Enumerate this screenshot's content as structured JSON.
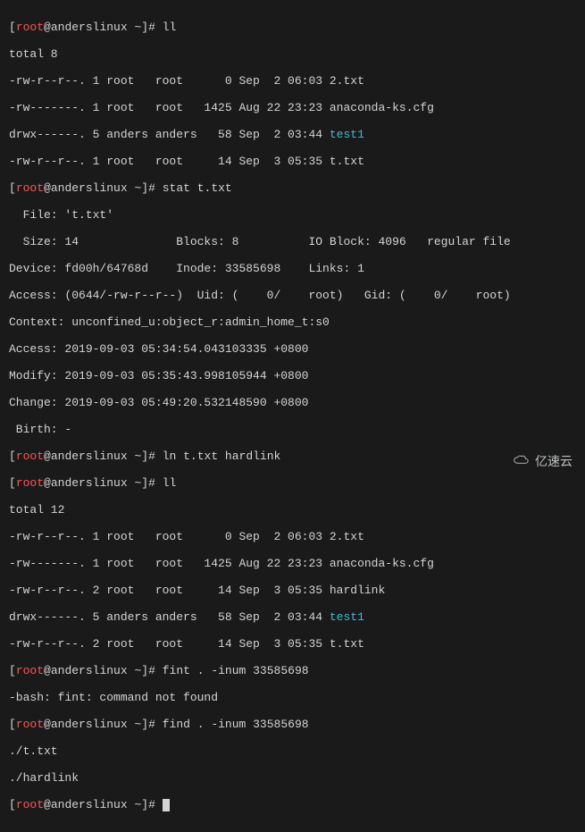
{
  "prompt": {
    "user": "root",
    "at": "@",
    "host": "anderslinux",
    "path": "~",
    "open": "[",
    "close": "]#"
  },
  "cmds": {
    "c0": "ll",
    "c1": "stat t.txt",
    "c2": "ln t.txt hardlink",
    "c3": "ll",
    "c4": "fint . -inum 33585698",
    "c5": "find . -inum 33585698",
    "c6": ""
  },
  "out": {
    "ll1_total": "total 8",
    "ll1_r0": "-rw-r--r--. 1 root   root      0 Sep  2 06:03 2.txt",
    "ll1_r1": "-rw-------. 1 root   root   1425 Aug 22 23:23 anaconda-ks.cfg",
    "ll1_r2a": "drwx------. 5 anders anders   58 Sep  2 03:44 ",
    "ll1_r2b": "test1",
    "ll1_r3": "-rw-r--r--. 1 root   root     14 Sep  3 05:35 t.txt",
    "stat_file": "  File: 't.txt'",
    "stat_size": "  Size: 14              Blocks: 8          IO Block: 4096   regular file",
    "stat_device": "Device: fd00h/64768d    Inode: 33585698    Links: 1",
    "stat_access": "Access: (0644/-rw-r--r--)  Uid: (    0/    root)   Gid: (    0/    root)",
    "stat_ctx": "Context: unconfined_u:object_r:admin_home_t:s0",
    "stat_atime": "Access: 2019-09-03 05:34:54.043103335 +0800",
    "stat_mtime": "Modify: 2019-09-03 05:35:43.998105944 +0800",
    "stat_ctime": "Change: 2019-09-03 05:49:20.532148590 +0800",
    "stat_birth": " Birth: -",
    "ll2_total": "total 12",
    "ll2_r0": "-rw-r--r--. 1 root   root      0 Sep  2 06:03 2.txt",
    "ll2_r1": "-rw-------. 1 root   root   1425 Aug 22 23:23 anaconda-ks.cfg",
    "ll2_r2": "-rw-r--r--. 2 root   root     14 Sep  3 05:35 hardlink",
    "ll2_r3a": "drwx------. 5 anders anders   58 Sep  2 03:44 ",
    "ll2_r3b": "test1",
    "ll2_r4": "-rw-r--r--. 2 root   root     14 Sep  3 05:35 t.txt",
    "err_fint": "-bash: fint: command not found",
    "find_r0": "./t.txt",
    "find_r1": "./hardlink"
  },
  "watermark": {
    "text": "亿速云"
  }
}
